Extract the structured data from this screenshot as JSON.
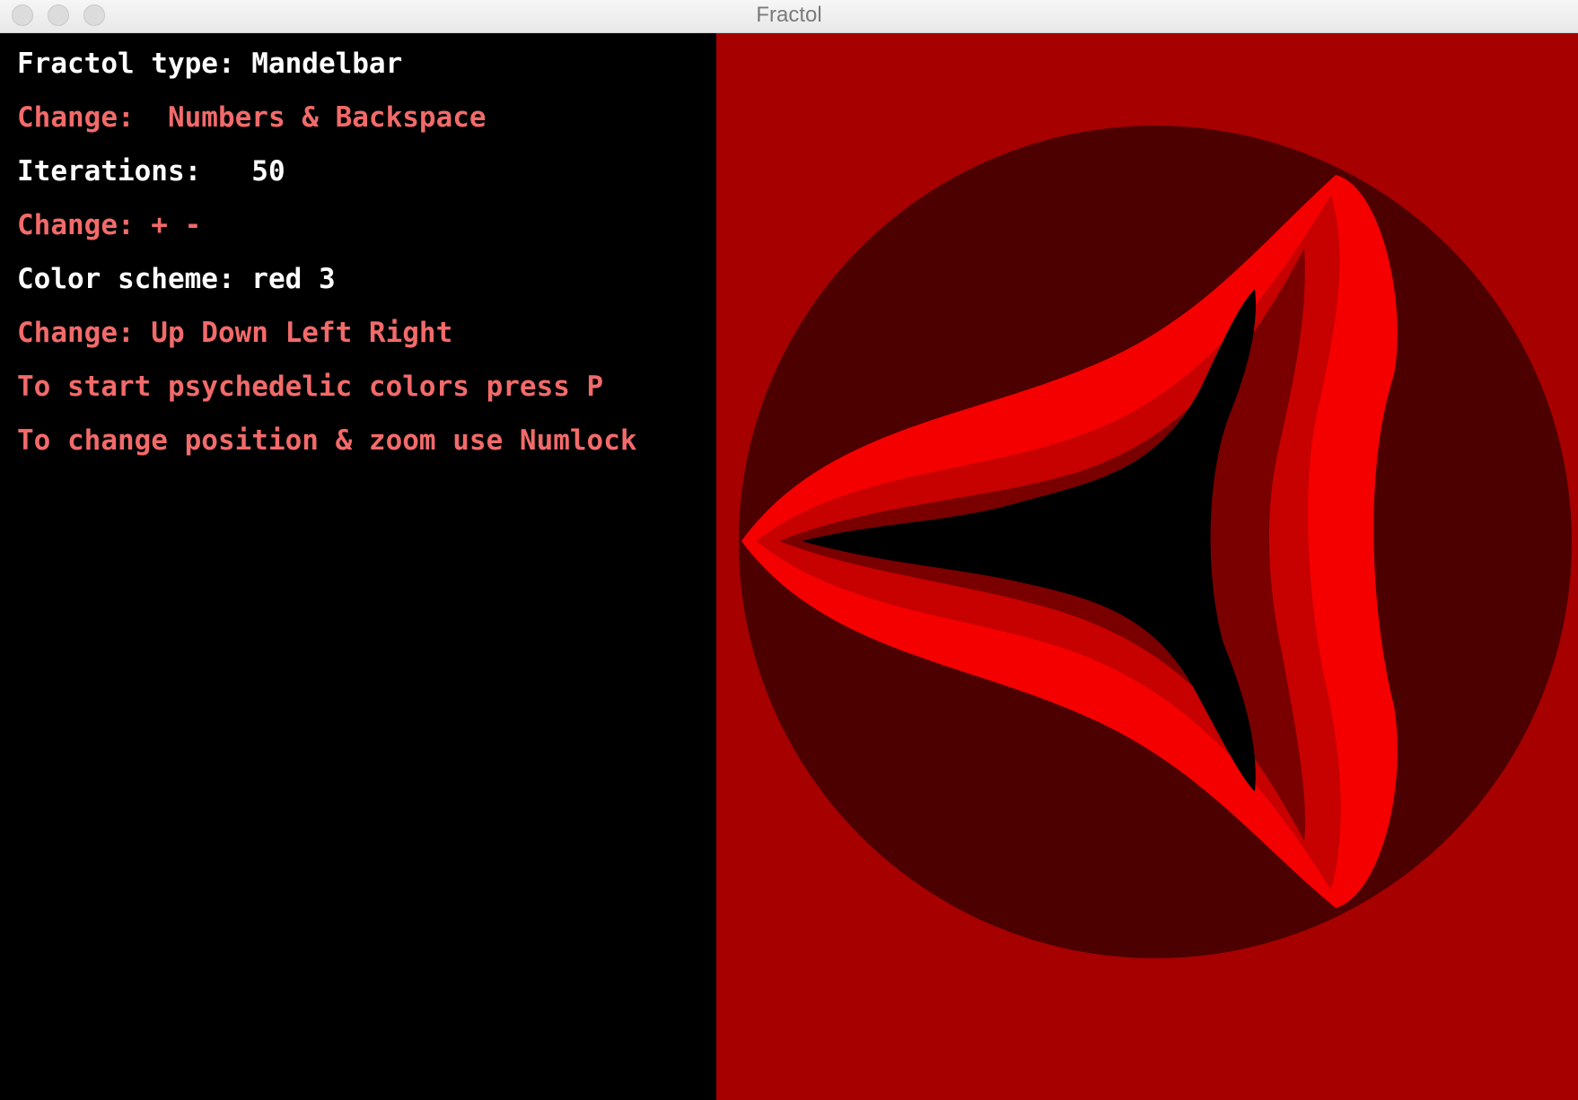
{
  "window": {
    "title": "Fractol"
  },
  "info": {
    "type_label": "Fractol type: Mandelbar",
    "type_change": "Change:  Numbers & Backspace",
    "iterations_label": "Iterations:   50",
    "iterations_change": "Change: + -",
    "color_label": "Color scheme: red 3",
    "color_change": "Change: Up Down Left Right",
    "psychedelic_hint": "To start psychedelic colors press P",
    "position_hint": "To change position & zoom use Numlock"
  },
  "colors": {
    "background_panel": "#000000",
    "info_text": "#ffffff",
    "hint_text": "#f26a6a",
    "fractal_bg": "#a60000",
    "fractal_dark": "#4d0000",
    "fractal_bright": "#f50000",
    "fractal_mid": "#c70000",
    "fractal_core": "#000000"
  }
}
